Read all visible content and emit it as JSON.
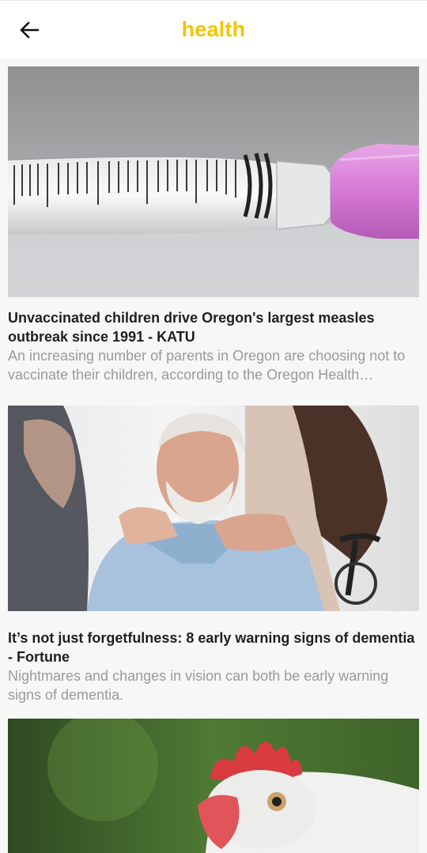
{
  "header": {
    "back_icon": "arrow-left-icon",
    "title": "health",
    "title_color": "#f2c500"
  },
  "articles": [
    {
      "image": "syringe-photo",
      "headline": "Unvaccinated children drive Oregon's largest measles outbreak since 1991 - KATU",
      "summary": "An increasing number of parents in Oregon are choosing not to vaccinate their children, according to the Oregon Health Authority."
    },
    {
      "image": "elderly-man-caregiver-photo",
      "headline": "It’s not just forgetfulness: 8 early warning signs of dementia - Fortune",
      "summary": "Nightmares and changes in vision can both be early warning signs of dementia."
    },
    {
      "image": "chicken-photo",
      "headline": "",
      "summary": ""
    }
  ]
}
